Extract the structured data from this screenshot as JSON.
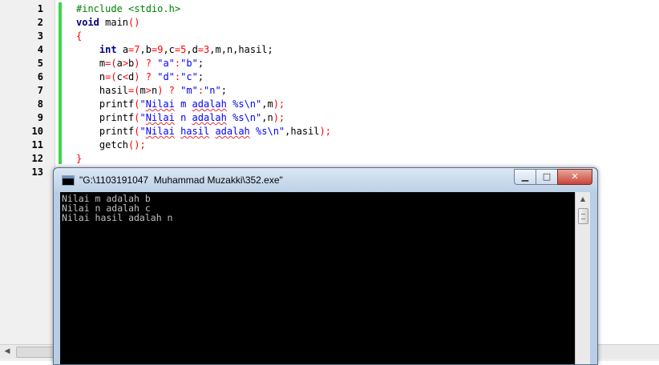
{
  "editor": {
    "line_numbers": [
      "1",
      "2",
      "3",
      "4",
      "5",
      "6",
      "7",
      "8",
      "9",
      "10",
      "11",
      "12",
      "13"
    ],
    "lines": [
      [
        {
          "t": "#include <stdio.h>",
          "c": "pp"
        }
      ],
      [
        {
          "t": "void",
          "c": "kw"
        },
        {
          "t": " main",
          "c": "plain"
        },
        {
          "t": "()",
          "c": "op"
        }
      ],
      [
        {
          "t": "{",
          "c": "op"
        }
      ],
      [
        {
          "t": "    ",
          "c": "plain"
        },
        {
          "t": "int",
          "c": "kw"
        },
        {
          "t": " a",
          "c": "plain"
        },
        {
          "t": "=",
          "c": "op"
        },
        {
          "t": "7",
          "c": "num-c"
        },
        {
          "t": ",b",
          "c": "plain"
        },
        {
          "t": "=",
          "c": "op"
        },
        {
          "t": "9",
          "c": "num-c"
        },
        {
          "t": ",c",
          "c": "plain"
        },
        {
          "t": "=",
          "c": "op"
        },
        {
          "t": "5",
          "c": "num-c"
        },
        {
          "t": ",d",
          "c": "plain"
        },
        {
          "t": "=",
          "c": "op"
        },
        {
          "t": "3",
          "c": "num-c"
        },
        {
          "t": ",m,n,hasil;",
          "c": "plain"
        }
      ],
      [
        {
          "t": "    m",
          "c": "plain"
        },
        {
          "t": "=(",
          "c": "op"
        },
        {
          "t": "a",
          "c": "plain"
        },
        {
          "t": ">",
          "c": "op"
        },
        {
          "t": "b",
          "c": "plain"
        },
        {
          "t": ")",
          "c": "op"
        },
        {
          "t": " ",
          "c": "plain"
        },
        {
          "t": "?",
          "c": "op"
        },
        {
          "t": " ",
          "c": "plain"
        },
        {
          "t": "\"a\"",
          "c": "str"
        },
        {
          "t": ":",
          "c": "op"
        },
        {
          "t": "\"b\"",
          "c": "str"
        },
        {
          "t": ";",
          "c": "plain"
        }
      ],
      [
        {
          "t": "    n",
          "c": "plain"
        },
        {
          "t": "=(",
          "c": "op"
        },
        {
          "t": "c",
          "c": "plain"
        },
        {
          "t": "<",
          "c": "op"
        },
        {
          "t": "d",
          "c": "plain"
        },
        {
          "t": ")",
          "c": "op"
        },
        {
          "t": " ",
          "c": "plain"
        },
        {
          "t": "?",
          "c": "op"
        },
        {
          "t": " ",
          "c": "plain"
        },
        {
          "t": "\"d\"",
          "c": "str"
        },
        {
          "t": ":",
          "c": "op"
        },
        {
          "t": "\"c\"",
          "c": "str"
        },
        {
          "t": ";",
          "c": "plain"
        }
      ],
      [
        {
          "t": "    hasil",
          "c": "plain"
        },
        {
          "t": "=(",
          "c": "op"
        },
        {
          "t": "m",
          "c": "plain"
        },
        {
          "t": ">",
          "c": "op"
        },
        {
          "t": "n",
          "c": "plain"
        },
        {
          "t": ")",
          "c": "op"
        },
        {
          "t": " ",
          "c": "plain"
        },
        {
          "t": "?",
          "c": "op"
        },
        {
          "t": " ",
          "c": "plain"
        },
        {
          "t": "\"m\"",
          "c": "str"
        },
        {
          "t": ":",
          "c": "op"
        },
        {
          "t": "\"n\"",
          "c": "str"
        },
        {
          "t": ";",
          "c": "plain"
        }
      ],
      [
        {
          "t": "    printf",
          "c": "plain"
        },
        {
          "t": "(",
          "c": "op"
        },
        {
          "t": "\"",
          "c": "str"
        },
        {
          "t": "Nilai",
          "c": "str sq"
        },
        {
          "t": " m ",
          "c": "str"
        },
        {
          "t": "adalah",
          "c": "str sq"
        },
        {
          "t": " %s\\n\"",
          "c": "str"
        },
        {
          "t": ",m",
          "c": "plain"
        },
        {
          "t": ");",
          "c": "op"
        }
      ],
      [
        {
          "t": "    printf",
          "c": "plain"
        },
        {
          "t": "(",
          "c": "op"
        },
        {
          "t": "\"",
          "c": "str"
        },
        {
          "t": "Nilai",
          "c": "str sq"
        },
        {
          "t": " n ",
          "c": "str"
        },
        {
          "t": "adalah",
          "c": "str sq"
        },
        {
          "t": " %s\\n\"",
          "c": "str"
        },
        {
          "t": ",n",
          "c": "plain"
        },
        {
          "t": ");",
          "c": "op"
        }
      ],
      [
        {
          "t": "    printf",
          "c": "plain"
        },
        {
          "t": "(",
          "c": "op"
        },
        {
          "t": "\"",
          "c": "str"
        },
        {
          "t": "Nilai",
          "c": "str sq"
        },
        {
          "t": " ",
          "c": "str"
        },
        {
          "t": "hasil",
          "c": "str sq"
        },
        {
          "t": " ",
          "c": "str"
        },
        {
          "t": "adalah",
          "c": "str sq"
        },
        {
          "t": " %s\\n\"",
          "c": "str"
        },
        {
          "t": ",hasil",
          "c": "plain"
        },
        {
          "t": ");",
          "c": "op"
        }
      ],
      [
        {
          "t": "    getch",
          "c": "plain"
        },
        {
          "t": "();",
          "c": "op"
        }
      ],
      [
        {
          "t": "}",
          "c": "op"
        }
      ],
      []
    ]
  },
  "console": {
    "title": "\"G:\\1103191047  Muhammad Muzakki\\352.exe\"",
    "minimize_glyph": "▁",
    "maximize_glyph": "□",
    "close_glyph": "✕",
    "output_lines": [
      "Nilai m adalah b",
      "Nilai n adalah c",
      "Nilai hasil adalah n"
    ]
  },
  "icons": {
    "scroll_left": "◀",
    "scroll_up": "▲"
  },
  "colors": {
    "change_bar": "#3cd64a",
    "keyword": "#000080",
    "string": "#0000ff",
    "number": "#ff0000",
    "preprocessor": "#008000"
  }
}
